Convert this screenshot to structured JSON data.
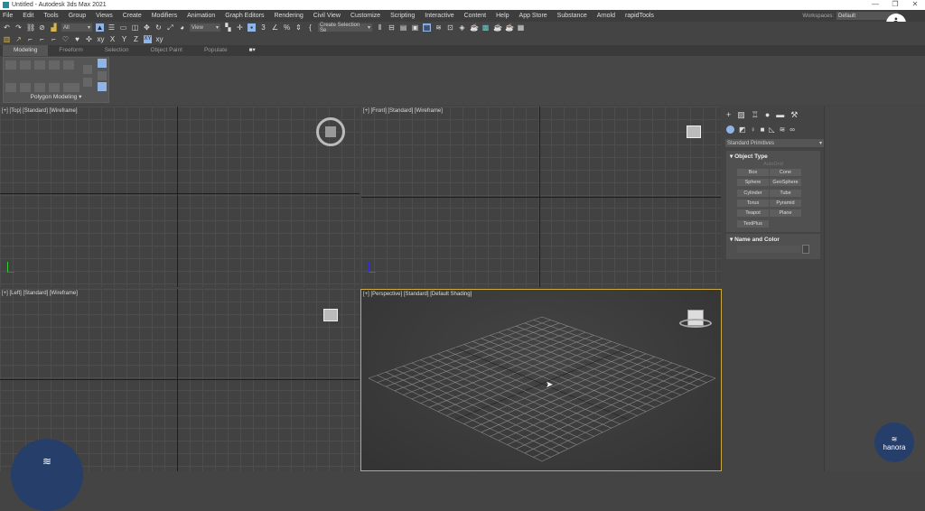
{
  "title": "Untitled - Autodesk 3ds Max 2021",
  "window_controls": [
    "—",
    "❐",
    "✕"
  ],
  "menu": [
    "File",
    "Edit",
    "Tools",
    "Group",
    "Views",
    "Create",
    "Modifiers",
    "Animation",
    "Graph Editors",
    "Rendering",
    "Civil View",
    "Customize",
    "Scripting",
    "Interactive",
    "Content",
    "Help",
    "App Store",
    "Substance",
    "Arnold",
    "rapidTools"
  ],
  "workspaces": {
    "label": "Workspaces:",
    "value": "Default"
  },
  "info_label": "i",
  "toolbar": {
    "selection_filter": "All",
    "ref_coord": "View",
    "selection_set": "Create Selection Se",
    "axes": [
      "X",
      "Y",
      "Z",
      "XY"
    ]
  },
  "ribbon": {
    "tabs": [
      "Modeling",
      "Freeform",
      "Selection",
      "Object Paint",
      "Populate"
    ],
    "panel_label": "Polygon Modeling ▾"
  },
  "viewports": {
    "top": "[+] [Top] [Standard] [Wireframe]",
    "front": "[+] [Front] [Standard] [Wireframe]",
    "left": "[+] [Left] [Standard] [Wireframe]",
    "perspective": "[+] [Perspective] [Standard] [Default Shading]"
  },
  "command_panel": {
    "category": "Standard Primitives",
    "object_type": "Object Type",
    "autogrid": "AutoGrid",
    "buttons": [
      "Box",
      "Cone",
      "Sphere",
      "GeoSphere",
      "Cylinder",
      "Tube",
      "Torus",
      "Pyramid",
      "Teapot",
      "Plane",
      "TextPlus"
    ],
    "name_and_color": "Name and Color"
  },
  "watermark": "hanora"
}
